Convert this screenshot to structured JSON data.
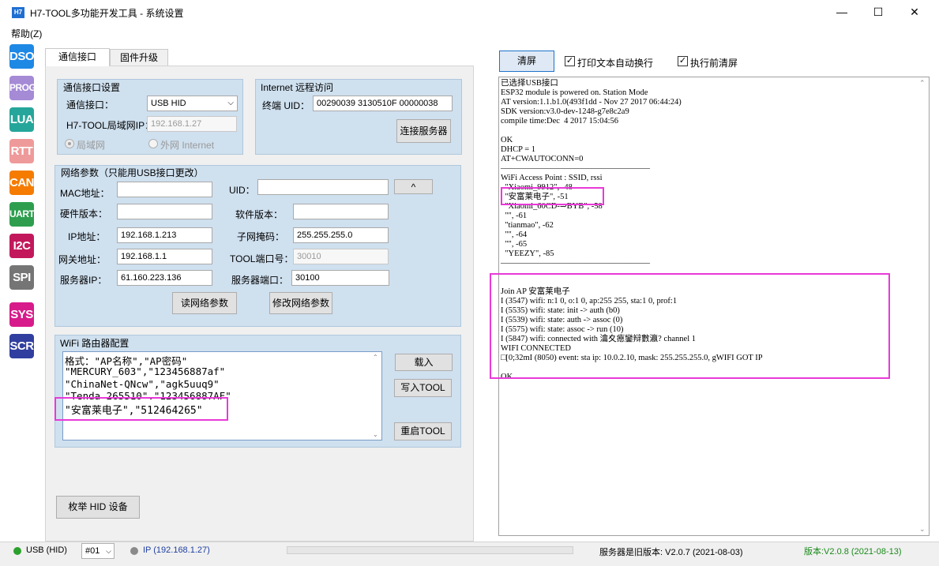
{
  "window": {
    "icon_text": "H7",
    "title": "H7-TOOL多功能开发工具 - 系统设置",
    "minimize": "—",
    "maximize": "☐",
    "close": "✕"
  },
  "menu": {
    "help": "帮助(Z)"
  },
  "sidebar": {
    "items": [
      {
        "label": "DSO",
        "color": "#1e88e5"
      },
      {
        "label": "PROG",
        "color": "#a58ad6"
      },
      {
        "label": "LUA",
        "color": "#26a69a"
      },
      {
        "label": "RTT",
        "color": "#ef9a9a"
      },
      {
        "label": "CAN",
        "color": "#f57c00"
      },
      {
        "label": "UART",
        "color": "#2e9e4e"
      },
      {
        "label": "I2C",
        "color": "#c2185b"
      },
      {
        "label": "SPI",
        "color": "#757575"
      },
      {
        "label": "SYS",
        "color": "#d81b8a"
      },
      {
        "label": "SCR",
        "color": "#303f9f"
      }
    ]
  },
  "tabs": [
    "通信接口",
    "固件升级"
  ],
  "comm": {
    "title": "通信接口设置",
    "iface_label": "通信接口：",
    "iface_value": "USB HID",
    "lan_ip_label": "H7-TOOL局域网IP：",
    "lan_ip_value": "192.168.1.27",
    "radio_lan": "局域网",
    "radio_wan": "外网 Internet"
  },
  "internet": {
    "title": "Internet 远程访问",
    "uid_label": "终端 UID：",
    "uid_value": "00290039 3130510F 00000038",
    "connect_btn": "连接服务器"
  },
  "net": {
    "title": "网络参数（只能用USB接口更改）",
    "mac_label": "MAC地址：",
    "mac_value": "",
    "uid_label": "UID：",
    "uid_value": "",
    "up_btn": "^",
    "hw_label": "硬件版本：",
    "hw_value": "",
    "sw_label": "软件版本：",
    "sw_value": "",
    "ip_label": "IP地址：",
    "ip_value": "192.168.1.213",
    "mask_label": "子网掩码：",
    "mask_value": "255.255.255.0",
    "gw_label": "网关地址：",
    "gw_value": "192.168.1.1",
    "port_label": "TOOL端口号：",
    "port_value": "30010",
    "srvip_label": "服务器IP：",
    "srvip_value": "61.160.223.136",
    "srvport_label": "服务器端口：",
    "srvport_value": "30100",
    "read_btn": "读网络参数",
    "write_btn": "修改网络参数"
  },
  "wifi": {
    "title": "WiFi 路由器配置",
    "lines": [
      "格式：\"AP名称\",\"AP密码\"",
      "\"MERCURY_603\",\"123456887af\"",
      "\"ChinaNet-QNcw\",\"agk5uuq9\"",
      "\"Tenda_265510\",\"123456887AF\"",
      "\"安富莱电子\",\"512464265\""
    ],
    "load_btn": "载入",
    "write_btn": "写入TOOL",
    "restart_btn": "重启TOOL"
  },
  "enum_btn": "枚举 HID 设备",
  "right": {
    "clear_btn": "清屏",
    "wrap_label": "打印文本自动换行",
    "clear_before_label": "执行前清屏",
    "wrap_checked": "✓",
    "clear_before_checked": "✓"
  },
  "console_lines": [
    "已选择USB接口",
    "ESP32 module is powered on. Station Mode",
    "AT version:1.1.b1.0(493f1dd - Nov 27 2017 06:44:24)",
    "SDK version:v3.0-dev-1248-g7e8c2a9",
    "compile time:Dec  4 2017 15:04:56",
    "",
    "OK",
    "DHCP = 1",
    "AT+CWAUTOCONN=0",
    "——————————————————",
    "WiFi Access Point : SSID, rssi",
    "  \"Xiaomi_9912\", -48",
    "  \"安富莱电子\", -51",
    "  \"Xiaomi_60CD-⇒BYB\", -58",
    "  \"\", -61",
    "  \"tianmao\", -62",
    "  \"\", -64",
    "  \"\", -65",
    "  \"YEEZY\", -85",
    "——————————————————",
    "",
    "",
    "Join AP 安富莱电子",
    "I (3547) wifi: n:1 0, o:1 0, ap:255 255, sta:1 0, prof:1",
    "I (5535) wifi: state: init -> auth (b0)",
    "I (5539) wifi: state: auth -> assoc (0)",
    "I (5575) wifi: state: assoc -> run (10)",
    "I (5847) wifi: connected with 瀹夊瘜鑾辩數瀛? channel 1",
    "WIFI CONNECTED",
    "□[0;32mI (8050) event: sta ip: 10.0.2.10, mask: 255.255.255.0, gWIFI GOT IP",
    "",
    "OK"
  ],
  "status": {
    "usb": "USB (HID)",
    "usb_color": "#2ca02c",
    "port": "#01",
    "ip": "IP (192.168.1.27)",
    "ip_color": "#8a8a8a",
    "server_version": "服务器是旧版本: V2.0.7 (2021-08-03)",
    "version": "版本:V2.0.8 (2021-08-13)",
    "version_color": "#1a8a1a"
  }
}
